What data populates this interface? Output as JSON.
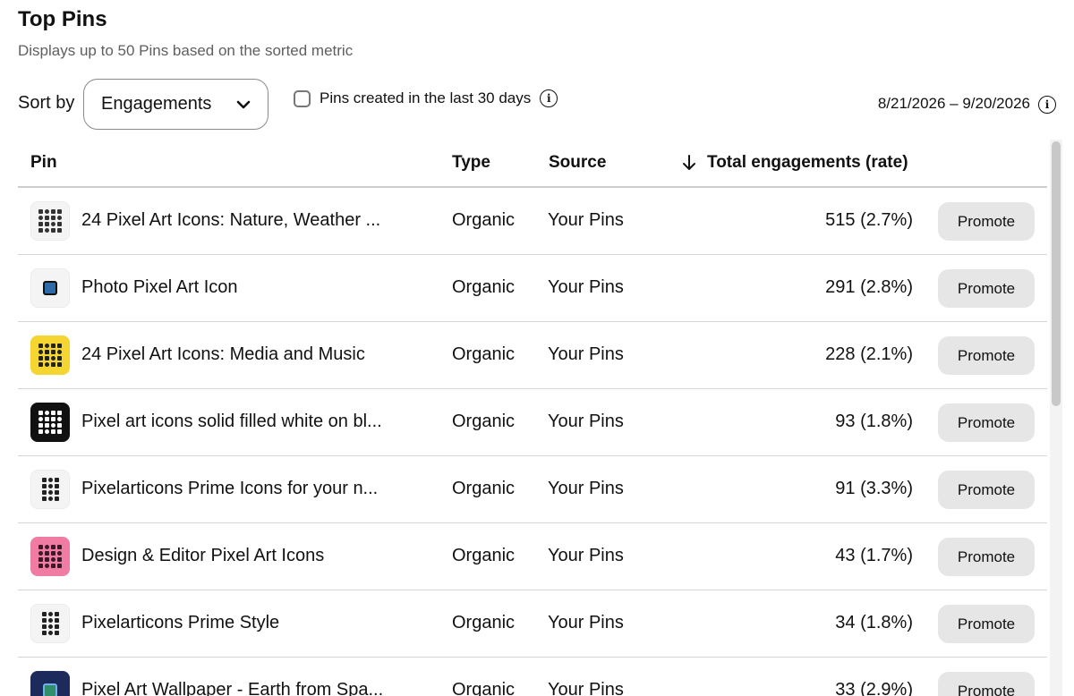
{
  "header": {
    "title": "Top Pins",
    "subtitle": "Displays up to 50 Pins based on the sorted metric"
  },
  "controls": {
    "sort_label": "Sort by",
    "sort_value": "Engagements",
    "checkbox_label": "Pins created in the last 30 days",
    "checkbox_checked": false,
    "date_range": "8/21/2026 – 9/20/2026"
  },
  "table": {
    "columns": {
      "pin": "Pin",
      "type": "Type",
      "source": "Source",
      "total": "Total engagements (rate)"
    },
    "rows": [
      {
        "title": "24 Pixel Art Icons: Nature, Weather ...",
        "type": "Organic",
        "source": "Your Pins",
        "metric": "515 (2.7%)",
        "action": "Promote",
        "thumb_icon": "pixel-icons-grid-white-icon"
      },
      {
        "title": "Photo Pixel Art Icon",
        "type": "Organic",
        "source": "Your Pins",
        "metric": "291 (2.8%)",
        "action": "Promote",
        "thumb_icon": "photo-pixel-icon"
      },
      {
        "title": "24 Pixel Art Icons: Media and Music",
        "type": "Organic",
        "source": "Your Pins",
        "metric": "228 (2.1%)",
        "action": "Promote",
        "thumb_icon": "pixel-icons-grid-yellow-icon"
      },
      {
        "title": "Pixel art icons solid filled white on bl...",
        "type": "Organic",
        "source": "Your Pins",
        "metric": "93 (1.8%)",
        "action": "Promote",
        "thumb_icon": "pixel-icons-grid-black-icon"
      },
      {
        "title": "Pixelarticons Prime Icons for your n...",
        "type": "Organic",
        "source": "Your Pins",
        "metric": "91 (3.3%)",
        "action": "Promote",
        "thumb_icon": "pixel-icons-grid-white-icon"
      },
      {
        "title": "Design & Editor Pixel Art Icons",
        "type": "Organic",
        "source": "Your Pins",
        "metric": "43 (1.7%)",
        "action": "Promote",
        "thumb_icon": "pixel-icons-grid-pink-icon"
      },
      {
        "title": "Pixelarticons Prime Style",
        "type": "Organic",
        "source": "Your Pins",
        "metric": "34 (1.8%)",
        "action": "Promote",
        "thumb_icon": "pixel-icons-grid-white-icon"
      },
      {
        "title": "Pixel Art Wallpaper - Earth from Spa...",
        "type": "Organic",
        "source": "Your Pins",
        "metric": "33 (2.9%)",
        "action": "Promote",
        "thumb_icon": "earth-wallpaper-icon"
      }
    ]
  },
  "colors": {
    "thumb_white": "#f4f4f4",
    "thumb_yellow": "#f5d631",
    "thumb_black": "#111111",
    "thumb_pink": "#f07ca3",
    "thumb_navy": "#1d2a5c",
    "button_bg": "#e6e6e6"
  }
}
